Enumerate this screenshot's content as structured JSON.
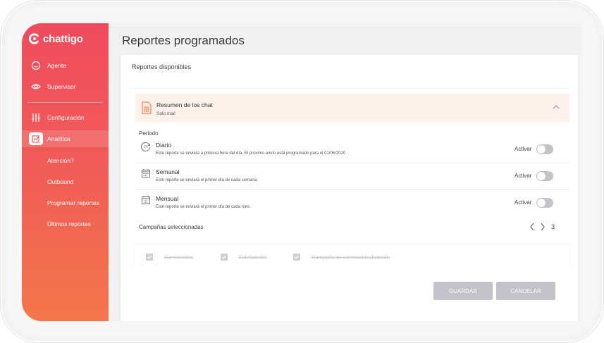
{
  "brand": {
    "name": "chattigo"
  },
  "sidebar": {
    "items": [
      {
        "label": "Agente"
      },
      {
        "label": "Supervisor"
      },
      {
        "label": "Configuración"
      },
      {
        "label": "Analítica"
      }
    ],
    "subitems": [
      {
        "label": "Atención?"
      },
      {
        "label": "Outbound"
      },
      {
        "label": "Programar reportes"
      },
      {
        "label": "Últimos reportes"
      }
    ]
  },
  "page": {
    "title": "Reportes programados"
  },
  "card": {
    "title": "Reportes disponibles"
  },
  "report": {
    "name": "Resumen de los chat",
    "subtitle": "Solo mail"
  },
  "period": {
    "label": "Periodo",
    "toggle_label": "Activar",
    "rows": [
      {
        "name": "Diario",
        "icon_text": "24",
        "description": "Este reporte se enviará a primera hora del día. El próximo envío está programado para el 01/06/2020"
      },
      {
        "name": "Semanal",
        "description": "Este reporte se enviará el primer día de cada semana."
      },
      {
        "name": "Mensual",
        "icon_text": "31",
        "description": "Este reporte se enviará el primer día de cada mes."
      }
    ]
  },
  "campaigns": {
    "label": "Campañas seleccionadas",
    "count": "3",
    "items": [
      {
        "label": "Bienvenidos"
      },
      {
        "label": "Fidelización"
      },
      {
        "label": "Campaña de internacionalización"
      }
    ]
  },
  "actions": {
    "save": "GUARDAR",
    "cancel": "CANCELAR"
  },
  "colors": {
    "sidebar_top": "#ef4c5e",
    "sidebar_bottom": "#f3774b",
    "accent": "#f07f4a",
    "disabled": "#c2c2c8"
  }
}
